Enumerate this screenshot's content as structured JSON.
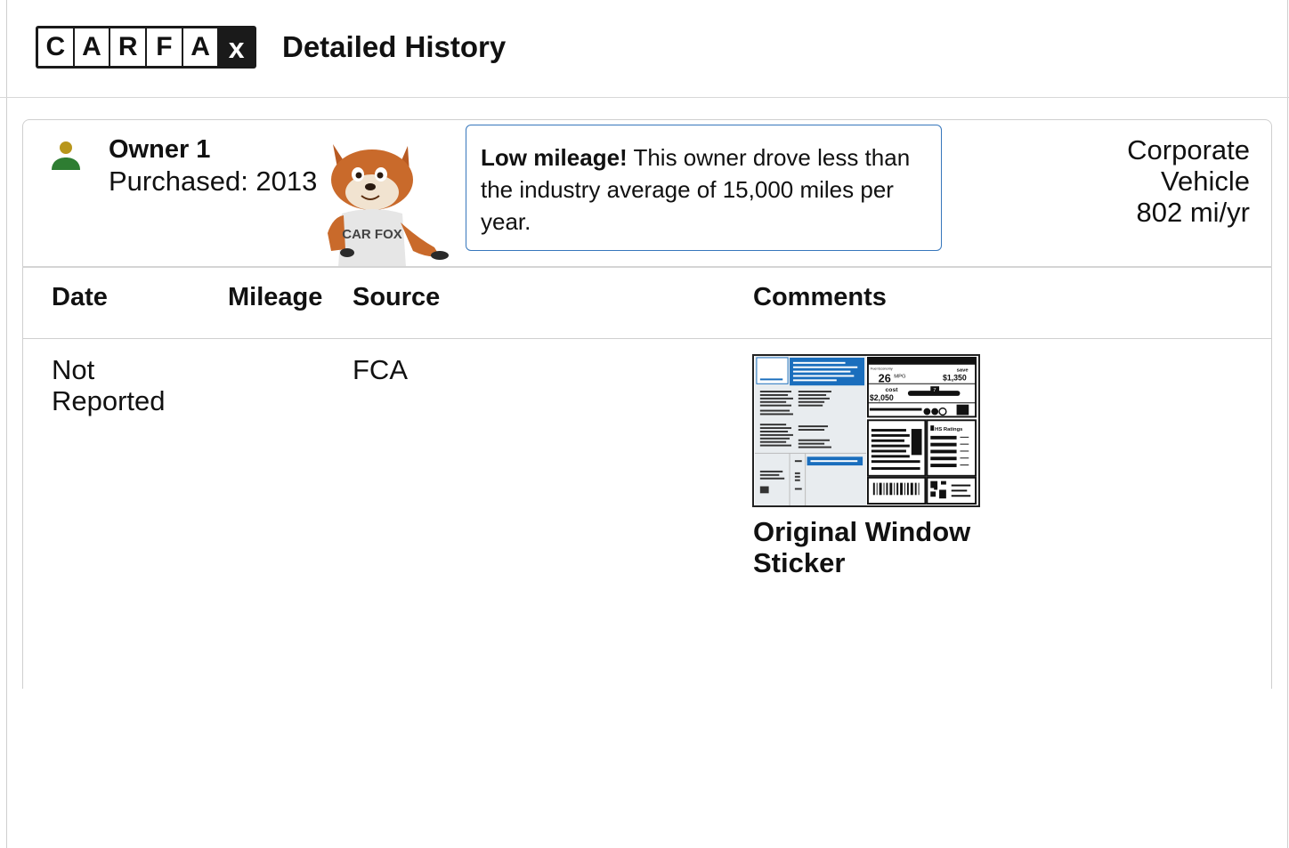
{
  "header": {
    "logo_letters": [
      "C",
      "A",
      "R",
      "F",
      "A",
      "x"
    ],
    "title": "Detailed History"
  },
  "owner": {
    "title": "Owner 1",
    "purchased": "Purchased: 2013",
    "callout_bold": "Low mileage!",
    "callout_text": " This owner drove less than the industry average of 15,000 miles per year.",
    "vehicle_type_line1": "Corporate",
    "vehicle_type_line2": "Vehicle",
    "mileage_per_year": "802 mi/yr",
    "fox_shirt_text": "CAR FOX"
  },
  "table": {
    "headers": {
      "date": "Date",
      "mileage": "Mileage",
      "source": "Source",
      "comments": "Comments"
    },
    "rows": [
      {
        "date": "Not Reported",
        "mileage": "",
        "source": "FCA",
        "comment_label": "Original Window Sticker"
      }
    ]
  },
  "sticker": {
    "mpg": "26",
    "mpg_unit": "MPG",
    "save_label": "save",
    "save_amount": "$1,350",
    "cost_label": "cost",
    "cost_amount": "$2,050",
    "rating_marker": "7",
    "ratings_label": "HS Ratings",
    "fuel_economy_label": "Fuel Economy"
  },
  "colors": {
    "accent_blue": "#3777bc",
    "owner_head": "#b8961c",
    "owner_body": "#2e7d32",
    "sticker_blue": "#1a6ebd"
  }
}
